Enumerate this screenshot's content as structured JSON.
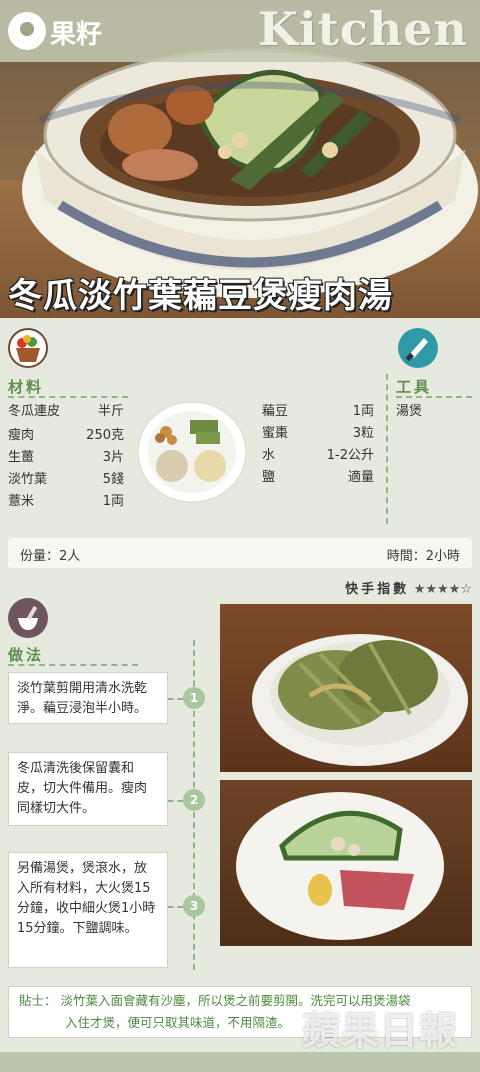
{
  "brand": {
    "name": "果籽",
    "section": "Kitchen"
  },
  "title": "冬瓜淡竹葉藊豆煲瘦肉湯",
  "ingredients": {
    "label": "材料",
    "items_left": [
      {
        "name": "冬瓜連皮",
        "amount": "半斤"
      },
      {
        "name": "瘦肉",
        "amount": "250克"
      },
      {
        "name": "生薑",
        "amount": "3片"
      },
      {
        "name": "淡竹葉",
        "amount": "5錢"
      },
      {
        "name": "薏米",
        "amount": "1両"
      }
    ],
    "items_right": [
      {
        "name": "藊豆",
        "amount": "1両"
      },
      {
        "name": "蜜棗",
        "amount": "3粒"
      },
      {
        "name": "水",
        "amount": "1-2公升"
      },
      {
        "name": "鹽",
        "amount": "適量"
      }
    ]
  },
  "tools": {
    "label": "工具",
    "items": [
      "湯煲"
    ]
  },
  "servings": "份量：2人",
  "time": "時間：2小時",
  "difficulty": {
    "label": "快手指數",
    "stars": "★★★★☆",
    "rating": 4,
    "max": 5
  },
  "method": {
    "label": "做法",
    "steps": [
      {
        "num": "1",
        "text": "淡竹葉剪開用清水洗乾淨。藊豆浸泡半小時。"
      },
      {
        "num": "2",
        "text": "冬瓜清洗後保留囊和皮，切大件備用。瘦肉同樣切大件。"
      },
      {
        "num": "3",
        "text": "另備湯煲，煲滾水，放入所有材料，大火煲15分鐘，收中細火煲1小時15分鐘。下鹽調味。"
      }
    ]
  },
  "tip": {
    "text": "貼士：  淡竹葉入面會藏有沙塵，所以煲之前要剪開。洗完可以用煲湯袋",
    "text2": "入住才煲，便可只取其味道，不用隔渣。"
  },
  "watermark": "蘋果日報",
  "colors": {
    "accent": "#5f8f4f",
    "step": "#a9c79d",
    "background": "#e6e9de"
  }
}
